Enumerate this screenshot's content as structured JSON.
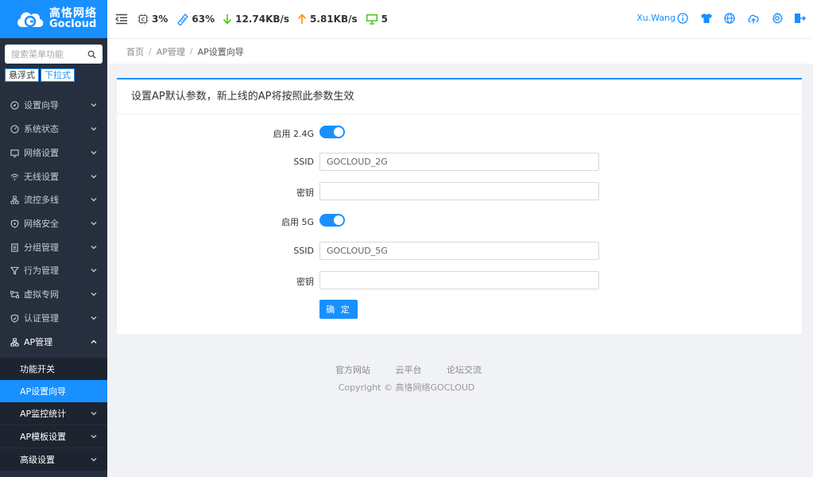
{
  "brand": {
    "name_cn": "高恪网络",
    "name_en": "Gocloud"
  },
  "sidebar": {
    "search_placeholder": "搜索菜单功能",
    "modes": [
      "悬浮式",
      "下拉式"
    ],
    "items": [
      {
        "label": "设置向导",
        "icon": "compass-icon"
      },
      {
        "label": "系统状态",
        "icon": "dashboard-icon"
      },
      {
        "label": "网络设置",
        "icon": "monitor-icon"
      },
      {
        "label": "无线设置",
        "icon": "wifi-icon"
      },
      {
        "label": "流控多线",
        "icon": "network-icon"
      },
      {
        "label": "网络安全",
        "icon": "shield-icon"
      },
      {
        "label": "分组管理",
        "icon": "document-icon"
      },
      {
        "label": "行为管理",
        "icon": "filter-icon"
      },
      {
        "label": "虚拟专网",
        "icon": "vpn-icon"
      },
      {
        "label": "认证管理",
        "icon": "shield-check-icon"
      },
      {
        "label": "AP管理",
        "icon": "sitemap-icon"
      }
    ],
    "subitems": [
      {
        "label": "功能开关"
      },
      {
        "label": "AP设置向导"
      },
      {
        "label": "AP监控统计"
      },
      {
        "label": "AP模板设置"
      },
      {
        "label": "高级设置"
      }
    ]
  },
  "header": {
    "cpu": "3%",
    "memory": "63%",
    "download": "12.74KB/s",
    "upload": "5.81KB/s",
    "terminals": "5",
    "user": "Xu.Wang"
  },
  "breadcrumb": [
    "首页",
    "AP管理",
    "AP设置向导"
  ],
  "card": {
    "title": "设置AP默认参数，新上线的AP将按照此参数生效",
    "enable_24_label": "启用 2.4G",
    "enable_24": true,
    "ssid_24_label": "SSID",
    "ssid_24": "GOCLOUD_2G",
    "key_24_label": "密钥",
    "key_24": "",
    "enable_5_label": "启用 5G",
    "enable_5": true,
    "ssid_5_label": "SSID",
    "ssid_5": "GOCLOUD_5G",
    "key_5_label": "密钥",
    "key_5": "",
    "confirm_label": "确 定"
  },
  "footer": {
    "links": [
      "官方网站",
      "云平台",
      "论坛交流"
    ],
    "copyright": "Copyright © 高恪网络GOCLOUD"
  },
  "colors": {
    "accent": "#1890ff",
    "sidebar": "#262f3e",
    "download": "#52c41a",
    "upload": "#fa8c16"
  }
}
